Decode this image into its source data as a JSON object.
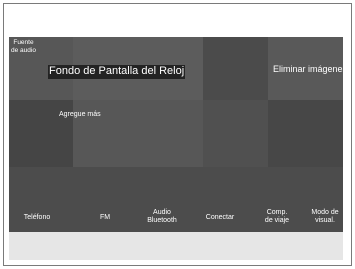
{
  "header": {
    "source_label": "Fuente\nde audio"
  },
  "main": {
    "wallpaper_label": "Fondo de Pantalla del Reloj",
    "delete_images_label": "Eliminar imágenes",
    "add_more_label": "Agregue más"
  },
  "bottom_bar": {
    "items": [
      {
        "label": "Teléfono"
      },
      {
        "label": "FM"
      },
      {
        "label": "Audio\nBluetooth"
      },
      {
        "label": "Conectar"
      },
      {
        "label": "Comp.\nde viaje"
      },
      {
        "label": "Modo de\nvisual."
      }
    ]
  },
  "colors": {
    "screen_bg": "#525252",
    "tile_light": "#5b5b5b",
    "tile_dark": "#474747",
    "bar_bg": "#4c4c4c",
    "text": "#ffffff",
    "frame": "#7a7a7a"
  }
}
